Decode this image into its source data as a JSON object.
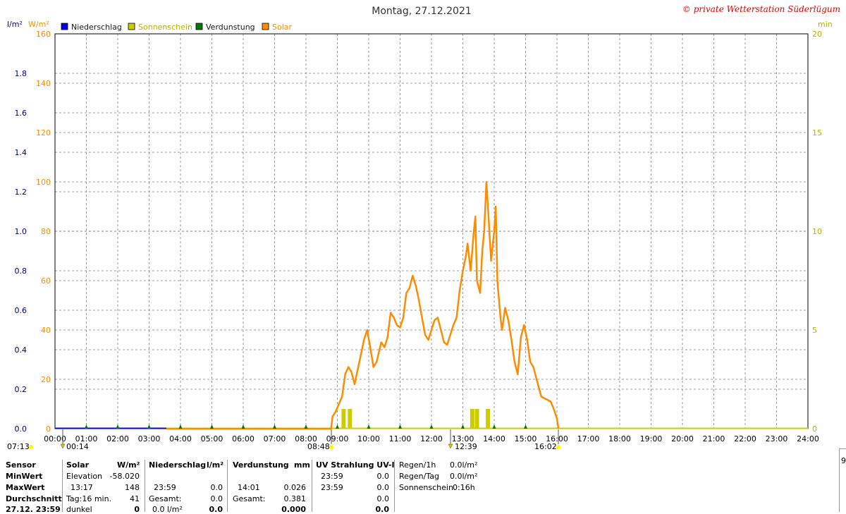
{
  "title": "Montag, 27.12.2021",
  "copyright": "© private Wetterstation Süderlügum",
  "axis_units": {
    "left_primary": "l/m²",
    "left_secondary": "W/m²",
    "right": "min"
  },
  "legend": [
    {
      "label": "Niederschlag",
      "color": "#0000e6"
    },
    {
      "label": "Sonnenschein",
      "color": "#cccc00"
    },
    {
      "label": "Verdunstung",
      "color": "#007a00"
    },
    {
      "label": "Solar",
      "color": "#ff8c00"
    }
  ],
  "colors": {
    "title_text": "#333333",
    "copyright": "#e60000",
    "left_axis_primary": "#000080",
    "left_axis_secondary": "#ff8c00",
    "right_axis": "#b3b300",
    "grid": "#808080"
  },
  "chart_data": {
    "type": "line",
    "x_ticks": [
      "00:00",
      "01:00",
      "02:00",
      "03:00",
      "04:00",
      "05:00",
      "06:00",
      "07:00",
      "08:00",
      "09:00",
      "10:00",
      "11:00",
      "12:00",
      "13:00",
      "14:00",
      "15:00",
      "16:00",
      "17:00",
      "18:00",
      "19:00",
      "20:00",
      "21:00",
      "22:00",
      "23:00",
      "24:00"
    ],
    "xlim_hours": [
      0,
      24
    ],
    "y_left_primary": {
      "label": "l/m²",
      "ticks": [
        "0.0",
        "0.2",
        "0.4",
        "0.6",
        "0.8",
        "1.0",
        "1.2",
        "1.4",
        "1.6",
        "1.8"
      ],
      "lim": [
        0,
        2.0
      ]
    },
    "y_left_secondary": {
      "label": "W/m²",
      "ticks": [
        "0",
        "20",
        "40",
        "60",
        "80",
        "100",
        "120",
        "140",
        "160"
      ],
      "lim": [
        0,
        160
      ]
    },
    "y_right": {
      "label": "min",
      "ticks": [
        "0",
        "5",
        "10",
        "15",
        "20"
      ],
      "lim": [
        0,
        20
      ]
    },
    "grid": true,
    "series": [
      {
        "name": "Solar",
        "axis": "W/m²",
        "color": "#ff8c00",
        "points": [
          [
            3.55,
            0
          ],
          [
            8.8,
            0
          ],
          [
            8.85,
            5
          ],
          [
            8.95,
            7
          ],
          [
            9.05,
            10
          ],
          [
            9.15,
            13
          ],
          [
            9.25,
            22
          ],
          [
            9.35,
            25
          ],
          [
            9.45,
            23
          ],
          [
            9.55,
            18
          ],
          [
            9.65,
            24
          ],
          [
            9.75,
            30
          ],
          [
            9.85,
            36
          ],
          [
            9.95,
            40
          ],
          [
            10.05,
            33
          ],
          [
            10.15,
            25
          ],
          [
            10.25,
            27
          ],
          [
            10.4,
            35
          ],
          [
            10.5,
            33
          ],
          [
            10.6,
            37
          ],
          [
            10.7,
            47
          ],
          [
            10.8,
            45
          ],
          [
            10.9,
            42
          ],
          [
            11.0,
            41
          ],
          [
            11.1,
            45
          ],
          [
            11.2,
            55
          ],
          [
            11.3,
            57
          ],
          [
            11.4,
            62
          ],
          [
            11.5,
            58
          ],
          [
            11.6,
            52
          ],
          [
            11.7,
            45
          ],
          [
            11.8,
            38
          ],
          [
            11.9,
            36
          ],
          [
            12.0,
            40
          ],
          [
            12.1,
            44
          ],
          [
            12.2,
            45
          ],
          [
            12.3,
            40
          ],
          [
            12.4,
            35
          ],
          [
            12.5,
            34
          ],
          [
            12.6,
            38
          ],
          [
            12.7,
            42
          ],
          [
            12.8,
            45
          ],
          [
            12.9,
            56
          ],
          [
            13.0,
            64
          ],
          [
            13.1,
            70
          ],
          [
            13.15,
            75
          ],
          [
            13.25,
            64
          ],
          [
            13.35,
            80
          ],
          [
            13.4,
            86
          ],
          [
            13.45,
            60
          ],
          [
            13.55,
            55
          ],
          [
            13.62,
            72
          ],
          [
            13.68,
            80
          ],
          [
            13.75,
            100
          ],
          [
            13.8,
            90
          ],
          [
            13.9,
            68
          ],
          [
            14.0,
            80
          ],
          [
            14.05,
            90
          ],
          [
            14.1,
            60
          ],
          [
            14.2,
            45
          ],
          [
            14.25,
            40
          ],
          [
            14.35,
            49
          ],
          [
            14.45,
            44
          ],
          [
            14.55,
            36
          ],
          [
            14.65,
            27
          ],
          [
            14.75,
            22
          ],
          [
            14.85,
            37
          ],
          [
            14.95,
            42
          ],
          [
            15.05,
            36
          ],
          [
            15.15,
            27
          ],
          [
            15.25,
            25
          ],
          [
            15.35,
            20
          ],
          [
            15.5,
            13
          ],
          [
            15.65,
            12
          ],
          [
            15.8,
            11
          ],
          [
            15.9,
            8
          ],
          [
            16.0,
            4
          ],
          [
            16.05,
            0
          ]
        ]
      },
      {
        "name": "Sonnenschein",
        "axis": "min",
        "color": "#cccc00",
        "type": "bar",
        "bars": [
          [
            9.2,
            1
          ],
          [
            9.4,
            1
          ],
          [
            13.3,
            1
          ],
          [
            13.45,
            1
          ],
          [
            13.8,
            1
          ]
        ]
      }
    ],
    "evaporation_marker_hours": [
      1,
      2,
      3,
      4,
      5,
      6,
      7,
      8,
      9,
      10,
      11,
      12,
      13,
      14,
      15
    ],
    "annotations": [
      "07:13",
      "00:14",
      "08:48",
      "12:39",
      "16:02"
    ]
  },
  "stats": {
    "sensor": {
      "label": "Sensor",
      "minwert": "MinWert",
      "maxwert": "MaxWert",
      "durchschnitt": "Durchschnitt",
      "datetime": "27.12. 23:59"
    },
    "solar": {
      "header": "Solar",
      "unit": "W/m²",
      "row1_label": "Elevation",
      "row1_val": "-58.020",
      "row2_label": "13:17",
      "row2_val": "148",
      "row3_label": "Tag:16 min.",
      "row3_val": "41",
      "row4_label": "dunkel",
      "row4_val": "0"
    },
    "niederschlag": {
      "header": "Niederschlag",
      "unit": "l/m²",
      "row2_label": "23:59",
      "row2_val": "0.0",
      "row3_label": "Gesamt:",
      "row3_val": "0.0",
      "row4_label": "0.0 l/m²",
      "row4_val": "0.0"
    },
    "verdunstung": {
      "header": "Verdunstung",
      "unit": "mm",
      "row2_label": "14:01",
      "row2_val": "0.026",
      "row3_label": "Gesamt:",
      "row3_val": "0.381",
      "row4_val": "0.000"
    },
    "uv": {
      "header": "UV Strahlung UV-I",
      "row1_label": "23:59",
      "row1_val": "0.0",
      "row2_label": "23:59",
      "row2_val": "0.0",
      "row3_val": "0.0",
      "row4_val": "0.0"
    },
    "regen": {
      "r1_label": "Regen/1h",
      "r1_val": "0.0l/m²",
      "r2_label": "Regen/Tag",
      "r2_val": "0.0l/m²",
      "r3_label": "Sonnenschein",
      "r3_val": "0:16h"
    }
  },
  "edge_label": "9"
}
